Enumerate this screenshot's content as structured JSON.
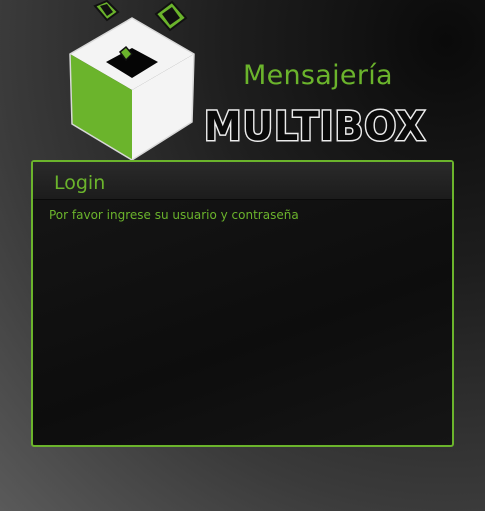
{
  "brand": {
    "subtitle": "Mensajería",
    "name": "MULTIBOX",
    "accent_color": "#6bb42c"
  },
  "login": {
    "title": "Login",
    "message": "Por favor ingrese su usuario y contraseña"
  }
}
